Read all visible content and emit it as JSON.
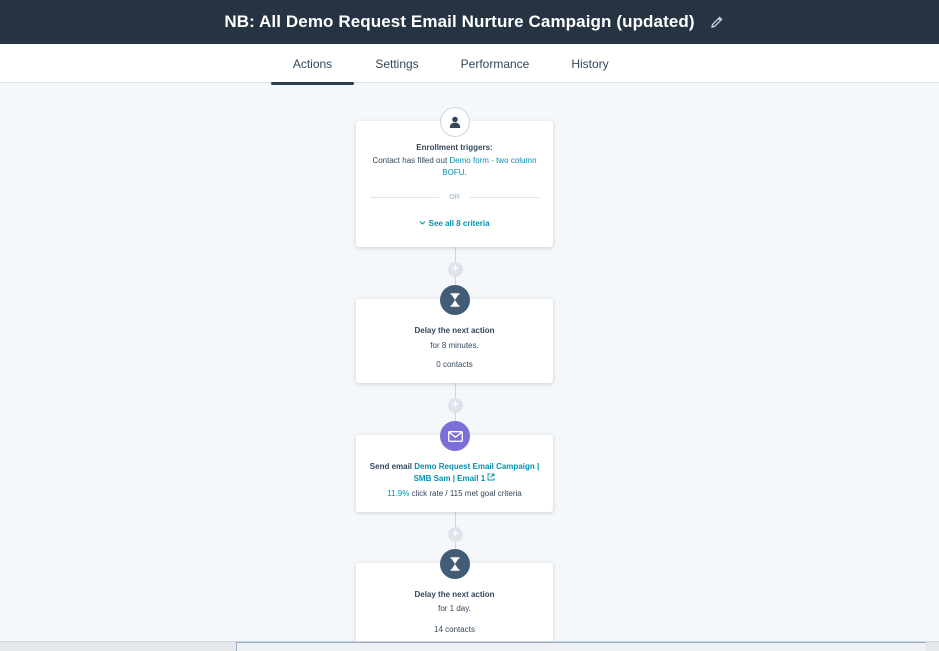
{
  "header": {
    "title": "NB: All Demo Request Email Nurture Campaign (updated)",
    "edit_icon": "pencil-icon"
  },
  "tabs": [
    {
      "label": "Actions",
      "active": true
    },
    {
      "label": "Settings",
      "active": false
    },
    {
      "label": "Performance",
      "active": false
    },
    {
      "label": "History",
      "active": false
    }
  ],
  "workflow": {
    "trigger": {
      "icon": "person-icon",
      "heading": "Enrollment triggers:",
      "prefix": "Contact has filled out",
      "form_link_line1": "Demo form - two column",
      "form_link_line2": "BOFU",
      "period": ".",
      "or": "OR",
      "see_all": "See all 8 criteria"
    },
    "delay1": {
      "icon": "hourglass-icon",
      "heading": "Delay the next action",
      "detail": "for 8 minutes.",
      "contacts": "0 contacts"
    },
    "email": {
      "icon": "envelope-icon",
      "label": "Send email",
      "link_line1": "Demo Request Email Campaign |",
      "link_line2": "SMB Sam | Email 1",
      "rate": "11.9%",
      "rate_suffix": "click rate / 115 met goal criteria"
    },
    "delay2": {
      "icon": "hourglass-icon",
      "heading": "Delay the next action",
      "detail": "for 1 day.",
      "contacts": "14 contacts"
    },
    "plus_label": "+"
  },
  "colors": {
    "topbar": "#253342",
    "accent_link": "#0091ae",
    "node_dark": "#425b76",
    "node_email": "#7c6fd9"
  }
}
